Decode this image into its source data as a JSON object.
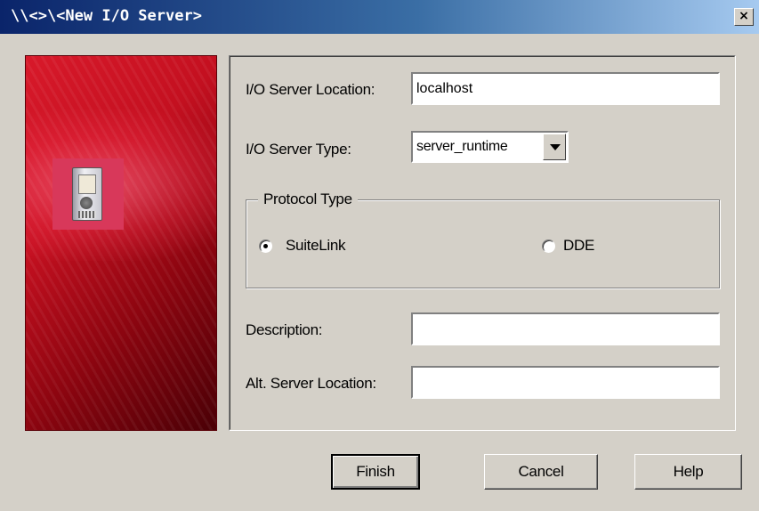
{
  "window": {
    "title": "\\\\<>\\<New I/O Server>",
    "close_glyph": "×"
  },
  "form": {
    "location_label": "I/O Server Location:",
    "location_value": "localhost",
    "type_label": "I/O Server Type:",
    "type_value": "server_runtime",
    "protocol_legend": "Protocol Type",
    "protocol_options": [
      "SuiteLink",
      "DDE"
    ],
    "protocol_selected": "SuiteLink",
    "description_label": "Description:",
    "description_value": "",
    "alt_location_label": "Alt. Server Location:",
    "alt_location_value": ""
  },
  "buttons": {
    "finish": "Finish",
    "cancel": "Cancel",
    "help": "Help"
  },
  "icons": {
    "banner": "io-server-icon"
  },
  "colors": {
    "title_start": "#0a246a",
    "title_end": "#a6caf0",
    "banner_red": "#c41020",
    "dialog_bg": "#d4d0c8"
  }
}
